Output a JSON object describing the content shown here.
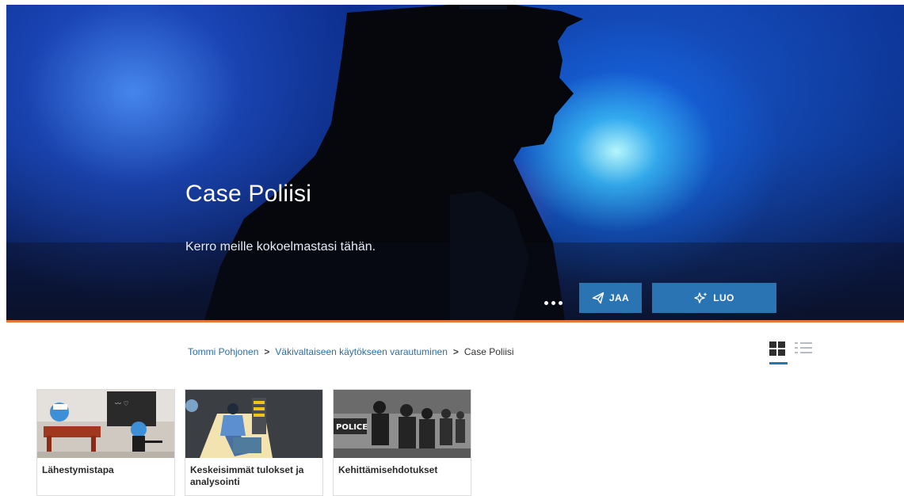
{
  "hero": {
    "title": "Case Poliisi",
    "subtitle": "Kerro meille kokoelmastasi tähän.",
    "more_icon": "more-dots-icon",
    "share_label": "JAA",
    "share_icon": "paper-plane-icon",
    "create_label": "LUO",
    "create_icon": "sparkle-icon"
  },
  "breadcrumb": {
    "items": [
      "Tommi Pohjonen",
      "Väkivaltaiseen käytökseen varautuminen"
    ],
    "current": "Case Poliisi",
    "separator": ">"
  },
  "view_toggle": {
    "options": [
      "grid-view-icon",
      "list-view-icon"
    ],
    "selected": "grid-view-icon"
  },
  "cards": [
    {
      "title": "Lähestymistapa"
    },
    {
      "title": "Keskeisimmät tulokset ja analysointi"
    },
    {
      "title": "Kehittämisehdotukset",
      "thumb_sign_text": "POLICE"
    }
  ],
  "colors": {
    "accent": "#2b74b4",
    "hero_rule": "#e8743b",
    "link": "#2d6ea5"
  }
}
